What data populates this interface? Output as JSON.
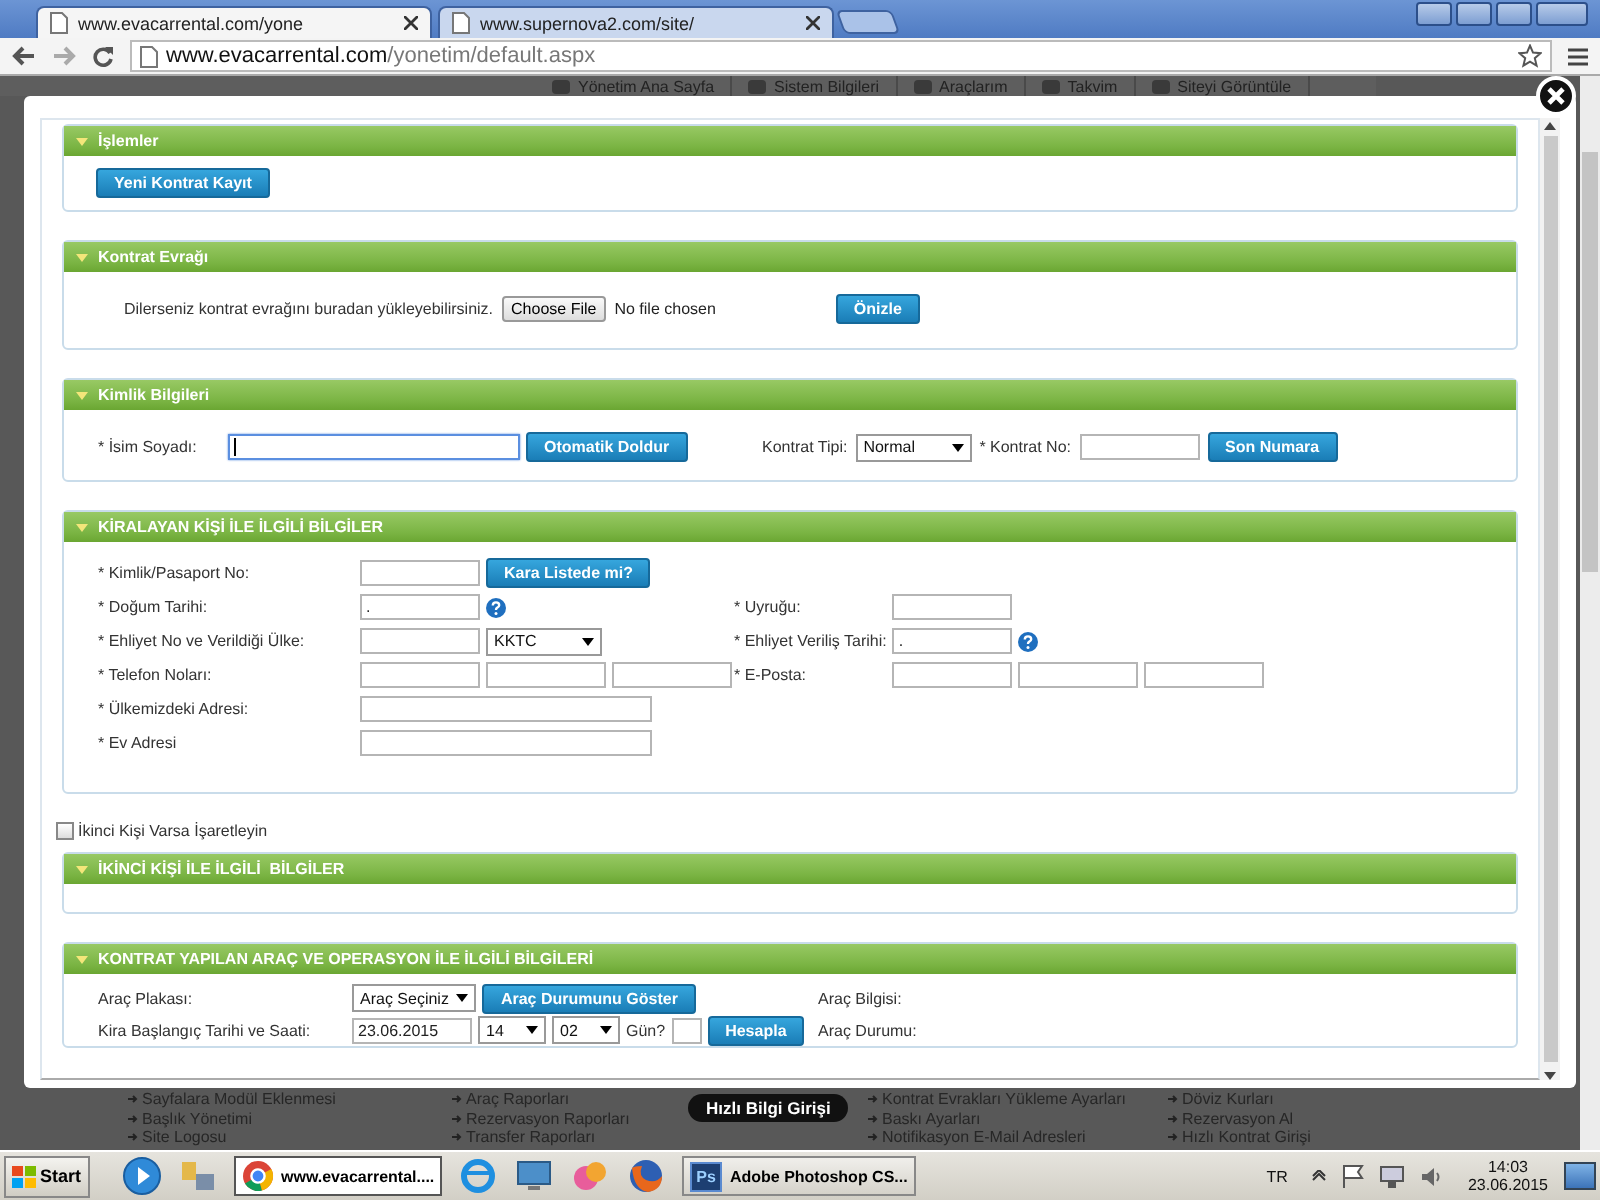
{
  "browser": {
    "tabs": [
      {
        "title": "www.evacarrental.com/yone",
        "selected": true
      },
      {
        "title": "www.supernova2.com/site/",
        "selected": false
      }
    ],
    "address": {
      "host": "www.evacarrental.com",
      "path": "/yonetim/default.aspx"
    }
  },
  "background_menu": [
    "Yönetim Ana Sayfa",
    "Sistem Bilgileri",
    "Araçlarım",
    "Takvim",
    "Siteyi Görüntüle"
  ],
  "modal": {
    "sections": [
      {
        "kind": "actions",
        "title": "İşlemler",
        "buttons": [
          "Yeni Kontrat Kayıt"
        ]
      },
      {
        "kind": "upload",
        "title": "Kontrat Evrağı",
        "text": "Dilerseniz kontrat evrağını buradan yükleyebilirsiniz.",
        "file_button": "Choose File",
        "file_status": "No file chosen",
        "button": "Önizle"
      },
      {
        "kind": "identity",
        "title": "Kimlik Bilgileri",
        "rows": [
          {
            "left": [
              {
                "kind": "label",
                "text": "* İsim Soyadı:"
              },
              {
                "kind": "long_input",
                "focused": true
              },
              {
                "kind": "button",
                "text": "Otomatik Doldur"
              }
            ],
            "right": [
              {
                "kind": "label",
                "text": "Kontrat Tipi:"
              },
              {
                "kind": "select",
                "value": "Normal"
              },
              {
                "kind": "label",
                "text": "* Kontrat No:"
              },
              {
                "kind": "input",
                "focused": false
              },
              {
                "kind": "button",
                "text": "Son Numara"
              }
            ]
          }
        ]
      },
      {
        "kind": "person",
        "title": "KİRALAYAN KİŞİ İLE İLGİLİ BİLGİLER",
        "rows": [
          {
            "left": [
              {
                "kind": "label",
                "text": "* Kimlik/Pasaport No:"
              },
              {
                "kind": "input",
                "focused": false
              },
              {
                "kind": "button",
                "text": "Kara Listede mi?"
              }
            ],
            "right": []
          },
          {
            "left": [
              {
                "kind": "label",
                "text": "* Doğum Tarihi:"
              },
              {
                "kind": "input",
                "value": ".",
                "focused": false
              },
              {
                "kind": "help"
              }
            ],
            "right": [
              {
                "kind": "label",
                "text": "* Uyruğu:"
              },
              {
                "kind": "input",
                "focused": false
              }
            ]
          },
          {
            "left": [
              {
                "kind": "label",
                "text": "* Ehliyet No ve Verildiği Ülke:"
              },
              {
                "kind": "input",
                "focused": false
              },
              {
                "kind": "select",
                "value": "KKTC"
              }
            ],
            "right": [
              {
                "kind": "label",
                "text": "* Ehliyet Veriliş Tarihi:"
              },
              {
                "kind": "input",
                "value": ".",
                "focused": false
              },
              {
                "kind": "help"
              }
            ]
          },
          {
            "left": [
              {
                "kind": "label",
                "text": "* Telefon Noları:"
              },
              {
                "kind": "input",
                "focused": false
              },
              {
                "kind": "input",
                "focused": false
              },
              {
                "kind": "input",
                "focused": false
              }
            ],
            "right": [
              {
                "kind": "label",
                "text": "* E-Posta:"
              },
              {
                "kind": "input",
                "focused": false
              },
              {
                "kind": "input",
                "focused": false
              },
              {
                "kind": "input",
                "focused": false
              }
            ]
          },
          {
            "left": [
              {
                "kind": "label",
                "text": "* Ülkemizdeki Adresi:"
              },
              {
                "kind": "long_input",
                "focused": false
              }
            ],
            "right": []
          },
          {
            "left": [
              {
                "kind": "label",
                "text": "* Ev Adresi"
              },
              {
                "kind": "long_input",
                "focused": false
              }
            ],
            "right": []
          }
        ]
      },
      {
        "kind": "checkbox",
        "label": "İkinci Kişi Varsa İşaretleyin",
        "checked": false
      },
      {
        "kind": "empty",
        "title": "İKİNCİ KİŞİ İLE İLGİLİ  BİLGİLER"
      },
      {
        "kind": "vehicle",
        "title": "KONTRAT YAPILAN ARAÇ VE OPERASYON İLE İLGİLİ BİLGİLERİ",
        "rows": [
          {
            "left": [
              {
                "kind": "label",
                "text": "Araç Plakası:"
              },
              {
                "kind": "select",
                "value": "Araç Seçiniz"
              },
              {
                "kind": "button",
                "text": "Araç Durumunu Göster"
              }
            ],
            "right": [
              {
                "kind": "label",
                "text": "Araç Bilgisi:"
              }
            ]
          },
          {
            "left": [
              {
                "kind": "label",
                "text": "Kira Başlangıç Tarihi ve Saati:"
              },
              {
                "kind": "input",
                "value": "23.06.2015",
                "focused": false
              },
              {
                "kind": "short_select",
                "value": "14"
              },
              {
                "kind": "short_select",
                "value": "02"
              },
              {
                "kind": "label",
                "text": "Gün?"
              },
              {
                "kind": "tiny_input",
                "focused": false
              },
              {
                "kind": "button",
                "text": "Hesapla"
              }
            ],
            "right": [
              {
                "kind": "label",
                "text": "Araç Durumu:"
              }
            ]
          }
        ]
      }
    ]
  },
  "footer_pill": "Hızlı Bilgi Girişi",
  "footer_columns": [
    [
      "Sayfalara Modül Eklenmesi",
      "Başlık Yönetimi",
      "Site Logosu"
    ],
    [
      "Araç Raporları",
      "Rezervasyon Raporları",
      "Transfer Raporları"
    ],
    [
      "Kontrat Evrakları Yükleme Ayarları",
      "Baskı Ayarları",
      "Notifikasyon E-Mail Adresleri"
    ],
    [
      "Döviz Kurları",
      "Rezervasyon Al",
      "Hızlı Kontrat Girişi"
    ]
  ],
  "taskbar": {
    "start": "Start",
    "tasks": [
      {
        "kind": "browser",
        "title": "www.evacarrental....",
        "selected": true
      },
      {
        "kind": "photoshop",
        "badge": "Ps",
        "title": "Adobe Photoshop CS...",
        "selected": false
      }
    ],
    "language": "TR",
    "time": "14:03",
    "date": "23.06.2015"
  }
}
